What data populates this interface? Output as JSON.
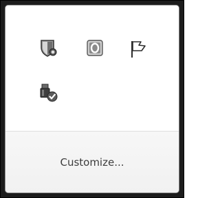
{
  "tray_overflow": {
    "icons": [
      {
        "name": "security-shield-icon"
      },
      {
        "name": "outlook-icon"
      },
      {
        "name": "action-center-flag-icon"
      },
      {
        "name": "safely-remove-hardware-icon"
      }
    ],
    "customize_label": "Customize..."
  }
}
